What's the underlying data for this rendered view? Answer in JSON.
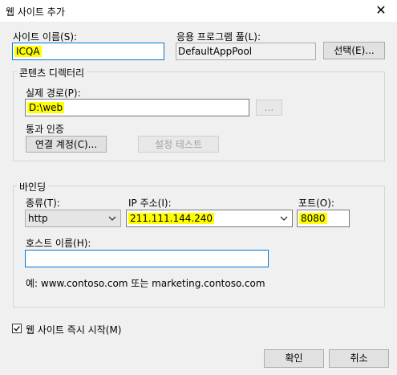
{
  "window": {
    "title": "웹 사이트 추가",
    "close_glyph": "✕"
  },
  "site_name": {
    "label": "사이트 이름(S):",
    "value": "ICQA"
  },
  "app_pool": {
    "label": "응용 프로그램 풀(L):",
    "value": "DefaultAppPool",
    "select_button": "선택(E)..."
  },
  "content_dir": {
    "group_title": "콘텐츠 디렉터리",
    "physical_path_label": "실제 경로(P):",
    "physical_path_value": "D:\\web",
    "browse_button": "...",
    "passthrough_label": "통과 인증",
    "connect_as_button": "연결 계정(C)...",
    "test_settings_button": "설정 테스트"
  },
  "binding": {
    "group_title": "바인딩",
    "type_label": "종류(T):",
    "type_value": "http",
    "ip_label": "IP 주소(I):",
    "ip_value": "211.111.144.240",
    "port_label": "포트(O):",
    "port_value": "8080",
    "hostname_label": "호스트 이름(H):",
    "hostname_value": "",
    "example_text": "예: www.contoso.com 또는 marketing.contoso.com"
  },
  "start_immediately": {
    "label": "웹 사이트 즉시 시작(M)",
    "checked": true
  },
  "buttons": {
    "ok": "확인",
    "cancel": "취소"
  },
  "colors": {
    "highlight": "#ffff00",
    "focus_border": "#0078d7",
    "background": "#f0f0f0"
  },
  "icons": {
    "close": "close-icon",
    "dropdown": "chevron-down-icon",
    "check": "checkmark-icon"
  }
}
